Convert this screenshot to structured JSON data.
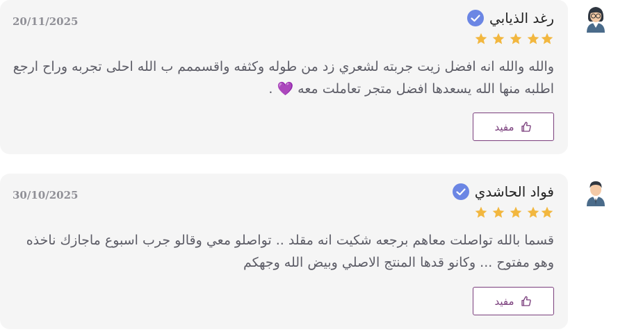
{
  "colors": {
    "card_bg": "#f5f5f5",
    "name": "#222222",
    "text": "#5c5c66",
    "date": "#8f8f96",
    "star": "#f2b73f",
    "verified": "#6b86e4",
    "button_border": "#7a3e7c"
  },
  "reviews": [
    {
      "author": "رغد الذيابي",
      "verified_icon": "verified-check-icon",
      "rating": 5,
      "date": "20/11/2025",
      "text": "والله والله انه افضل زيت جربته لشعري زد من طوله وكثفه واقسممم ب الله احلى تجربه وراح ارجع اطلبه منها الله يسعدها افضل متجر تعاملت معه 💜 .",
      "helpful_label": "مفيد",
      "avatar_icon": "female-avatar-icon"
    },
    {
      "author": "فواد الحاشدي",
      "verified_icon": "verified-check-icon",
      "rating": 5,
      "date": "30/10/2025",
      "text": "قسما بالله تواصلت معاهم برجعه شكيت انه مقلد .. تواصلو معي وقالو جرب اسبوع ماجازك ناخذه وهو مفتوح ... وكانو قدها المنتج الاصلي وبيض الله وجهكم",
      "helpful_label": "مفيد",
      "avatar_icon": "male-avatar-icon"
    }
  ]
}
